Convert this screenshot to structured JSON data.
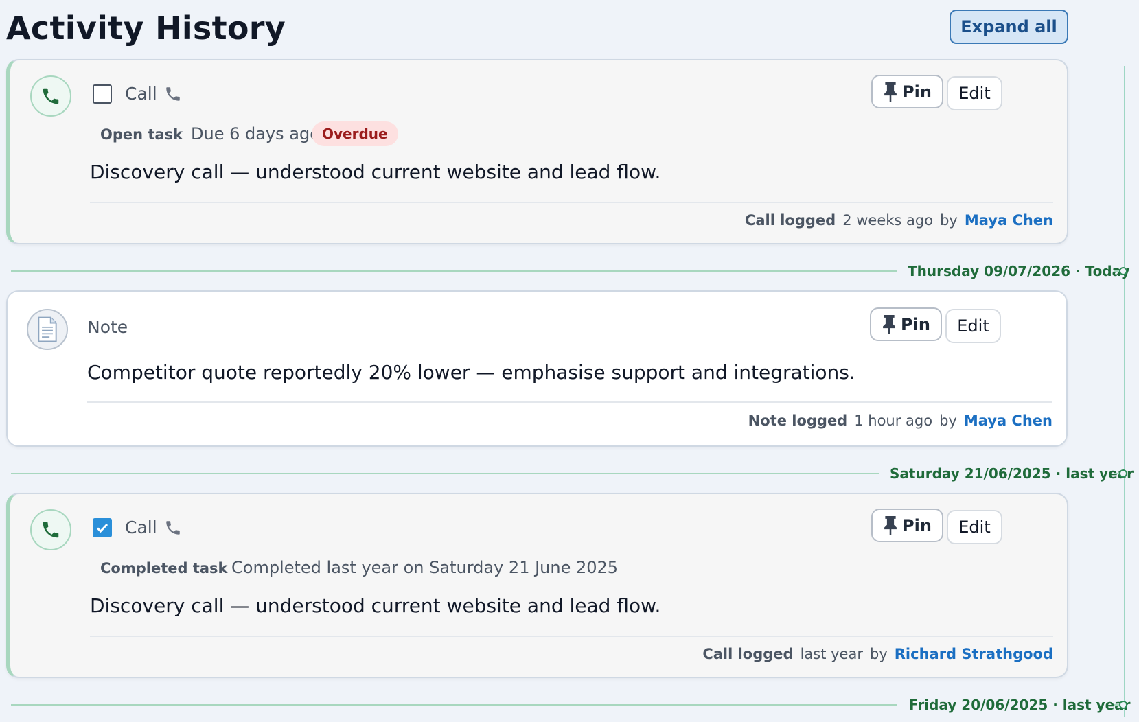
{
  "header": {
    "title": "Activity History",
    "expand_label": "Expand all"
  },
  "colors": {
    "accent_green": "#a8d7bf",
    "date_text": "#1f6b3a",
    "user_link": "#1b6fc2",
    "overdue_bg": "#fde0e0",
    "overdue_text": "#9b1c1c",
    "checkbox_checked": "#2a8fd9"
  },
  "activities": [
    {
      "type": "Call",
      "icon": "phone-icon",
      "checked": false,
      "task_state": "Open task",
      "task_date": "Due 6 days ago",
      "badge": "Overdue",
      "body": "Discovery call — understood current website and lead flow.",
      "footer_label": "Call logged",
      "footer_time": "2 weeks ago",
      "footer_by": "by",
      "footer_user": "Maya Chen",
      "pin_label": "Pin",
      "edit_label": "Edit"
    },
    {
      "type": "Note",
      "icon": "document-icon",
      "body": "Competitor quote reportedly 20% lower — emphasise support and integrations.",
      "footer_label": "Note logged",
      "footer_time": "1 hour ago",
      "footer_by": "by",
      "footer_user": "Maya Chen",
      "pin_label": "Pin",
      "edit_label": "Edit"
    },
    {
      "type": "Call",
      "icon": "phone-icon",
      "checked": true,
      "task_state": "Completed task",
      "task_date": "Completed last year on Saturday 21 June 2025",
      "body": "Discovery call — understood current website and lead flow.",
      "footer_label": "Call logged",
      "footer_time": "last year",
      "footer_by": "by",
      "footer_user": "Richard Strathgood",
      "pin_label": "Pin",
      "edit_label": "Edit"
    }
  ],
  "date_separators": [
    {
      "date": "Thursday 09/07/2026",
      "sep": "·",
      "relative": "Today"
    },
    {
      "date": "Saturday 21/06/2025",
      "sep": "·",
      "relative": "last year"
    },
    {
      "date": "Friday 20/06/2025",
      "sep": "·",
      "relative": "last year"
    }
  ]
}
